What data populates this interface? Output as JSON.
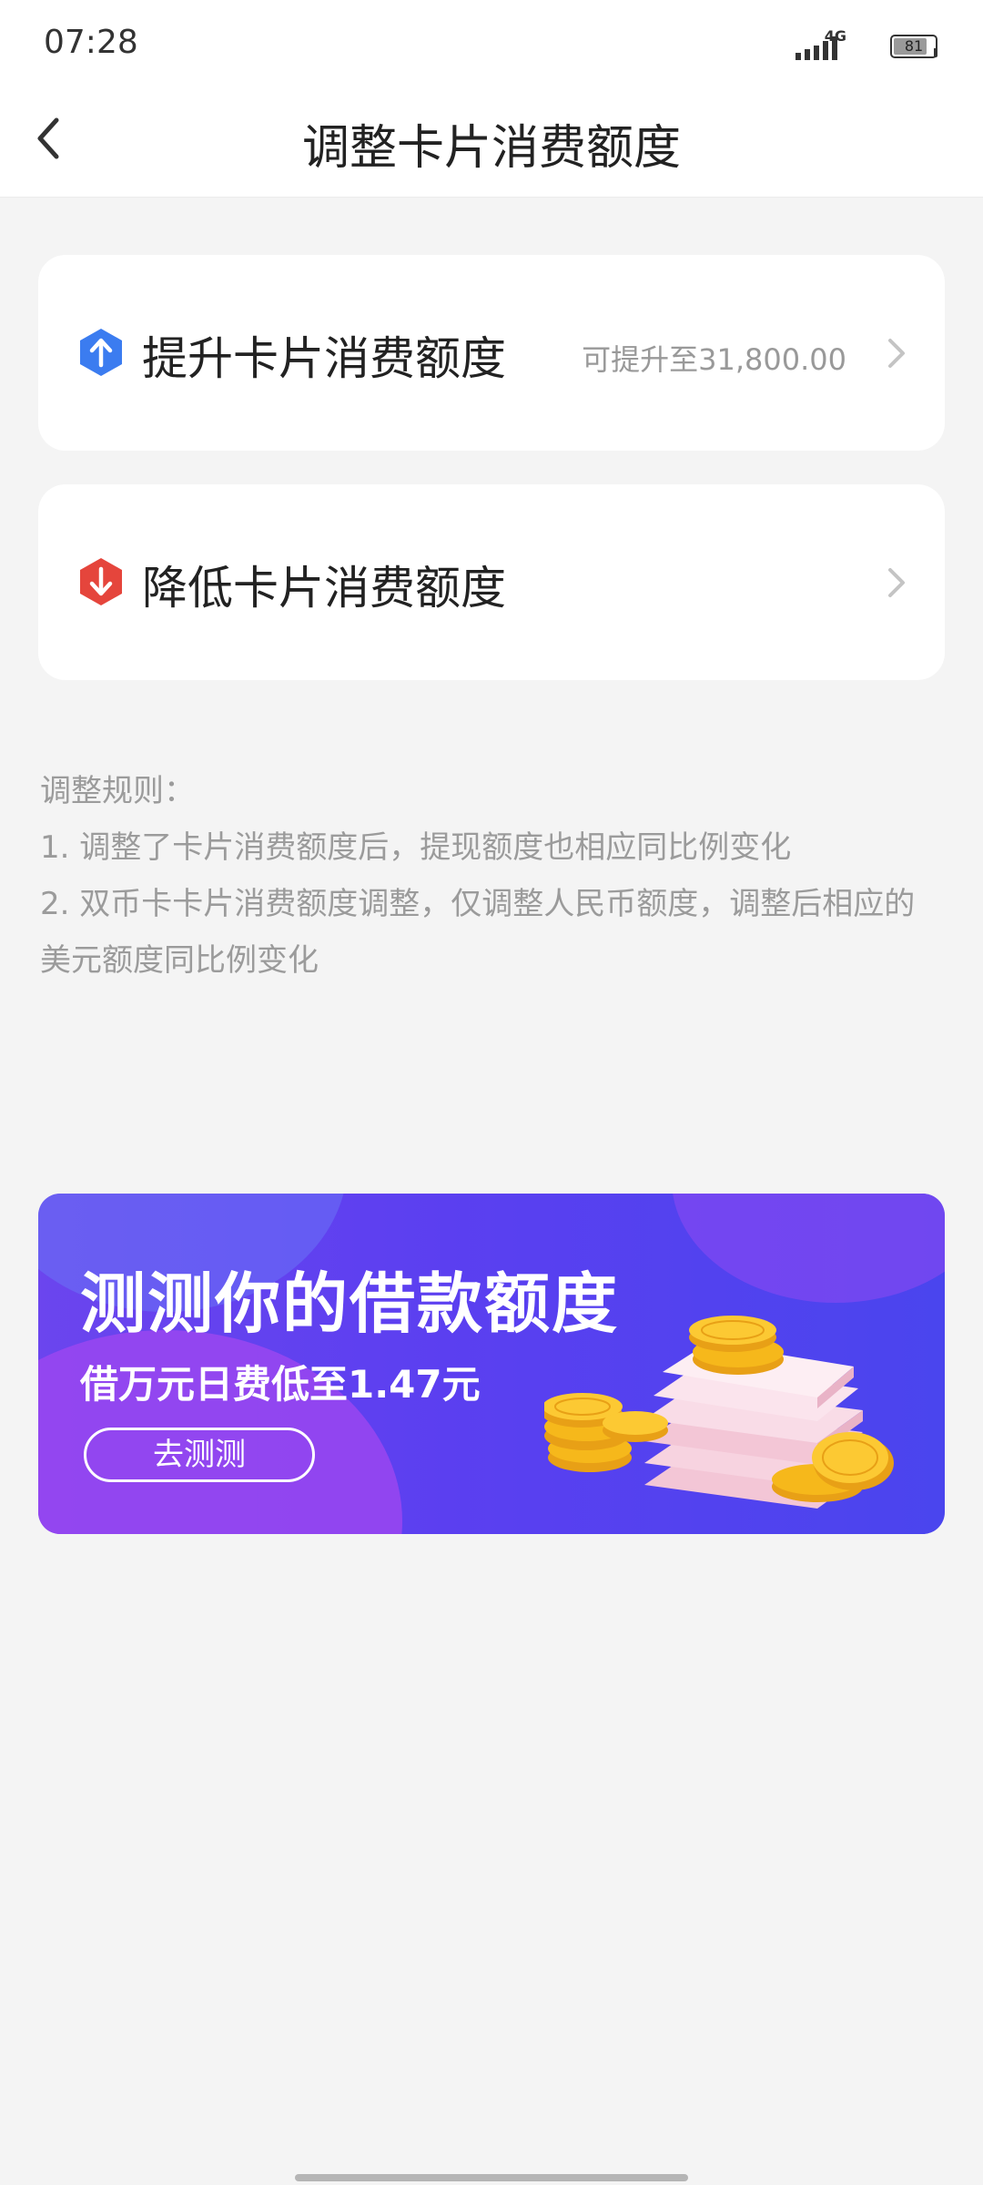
{
  "status_bar": {
    "time": "07:28",
    "network": "4G",
    "battery": "81",
    "battery_level": 0.81
  },
  "header": {
    "title": "调整卡片消费额度",
    "back_icon": "chevron-left-icon"
  },
  "options": [
    {
      "label": "提升卡片消费额度",
      "hint": "可提升至31,800.00",
      "icon": "arrow-up-icon",
      "icon_color": "#3b7cf0"
    },
    {
      "label": "降低卡片消费额度",
      "icon": "arrow-down-icon",
      "icon_color": "#e5453c"
    }
  ],
  "rules": {
    "title": "调整规则：",
    "items": [
      "1. 调整了卡片消费额度后，提现额度也相应同比例变化",
      "2. 双币卡卡片消费额度调整，仅调整人民币额度，调整后相应的美元额度同比例变化"
    ]
  },
  "banner": {
    "title": "测测你的借款额度",
    "subtitle": "借万元日费低至1.47元",
    "button": "去测测"
  },
  "colors": {
    "page_bg": "#f4f4f4",
    "banner_bg": "#5b3ff0",
    "coin": "#f6b81b"
  }
}
